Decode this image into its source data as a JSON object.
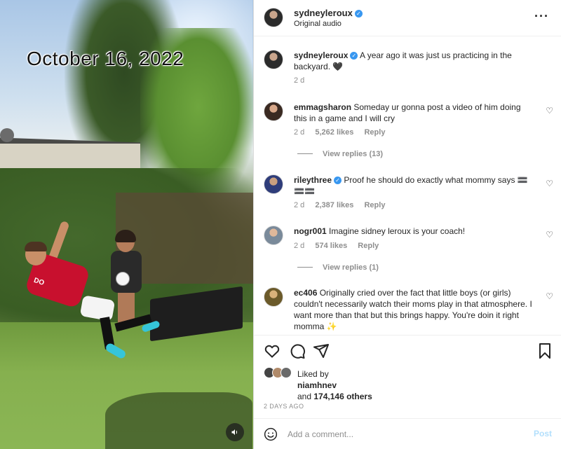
{
  "media": {
    "date_overlay": "October 16, 2022",
    "jersey_print": "DO",
    "audio_icon": "speaker-icon"
  },
  "header": {
    "username": "sydneyleroux",
    "audio": "Original audio",
    "more_icon": "more-options-icon"
  },
  "caption": {
    "username": "sydneyleroux",
    "text": "A year ago it was just us practicing in the backyard. 🖤",
    "time": "2 d"
  },
  "comments": [
    {
      "username": "emmagsharon",
      "text": "Someday ur gonna post a video of him doing this in a game and I will cry",
      "time": "2 d",
      "likes": "5,262 likes",
      "reply": "Reply",
      "view_replies": "View replies (13)",
      "verified": false
    },
    {
      "username": "rileythree",
      "text": "Proof he should do exactly what mommy says 🟰🟰🟰",
      "time": "2 d",
      "likes": "2,387 likes",
      "reply": "Reply",
      "view_replies": "",
      "verified": true
    },
    {
      "username": "nogr001",
      "text": "Imagine sidney leroux is your coach!",
      "time": "2 d",
      "likes": "574 likes",
      "reply": "Reply",
      "view_replies": "View replies (1)",
      "verified": false
    },
    {
      "username": "ec406",
      "text": "Originally cried over the fact that little boys (or girls) couldn't necessarily watch their moms play in that atmosphere. I want more than that but this brings happy. You're doin it right momma ✨",
      "verified": false
    }
  ],
  "likes": {
    "liked_by_label": "Liked by",
    "first_liker": "niamhnev",
    "and_label": "and",
    "others": "174,146 others"
  },
  "post_date": "2 DAYS AGO",
  "add_comment": {
    "placeholder": "Add a comment...",
    "post_label": "Post"
  },
  "colors": {
    "verified": "#3897f0",
    "post_button_disabled": "#b2dffc",
    "secondary_text": "#8e8e8e"
  }
}
